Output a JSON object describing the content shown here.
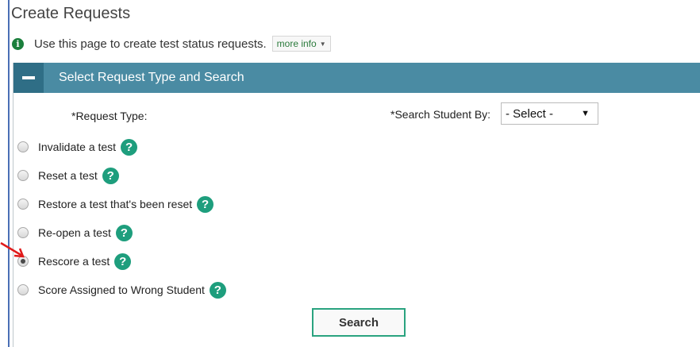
{
  "page": {
    "title": "Create Requests",
    "info_text": "Use this page to create test status requests.",
    "more_info_label": "more info"
  },
  "panel": {
    "title": "Select Request Type and Search",
    "request_type_label": "*Request Type:",
    "search_by_label": "*Search Student By:",
    "search_by_select_value": "- Select -",
    "search_button_label": "Search"
  },
  "options": [
    {
      "label": "Invalidate a test",
      "selected": false
    },
    {
      "label": "Reset a test",
      "selected": false
    },
    {
      "label": "Restore a test that's been reset",
      "selected": false
    },
    {
      "label": "Re-open a test",
      "selected": false
    },
    {
      "label": "Rescore a test",
      "selected": true
    },
    {
      "label": "Score Assigned to Wrong Student",
      "selected": false
    }
  ],
  "colors": {
    "header_bg": "#4a8ba3",
    "collapse_bg": "#2f6e86",
    "help_icon": "#1e9e7d",
    "button_border": "#2aa37f",
    "annotation_arrow": "#e01b1b"
  },
  "icons": {
    "info": "info-circle-icon",
    "help": "question-circle-icon",
    "collapse": "minus-icon",
    "dropdown": "caret-down-icon"
  }
}
